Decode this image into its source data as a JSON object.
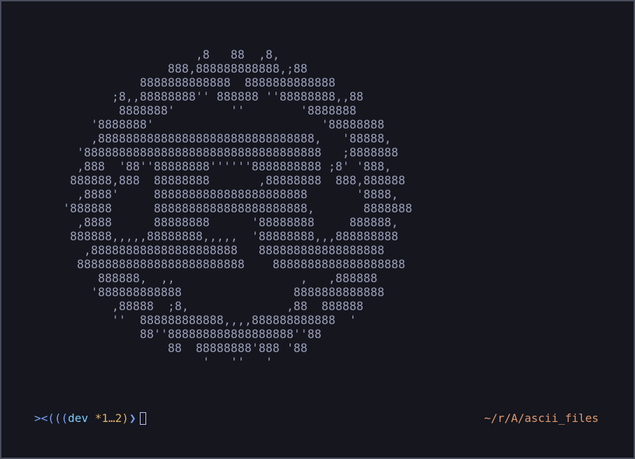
{
  "ascii_art": {
    "lines": [
      "                   ,8   88  ,8,",
      "               888,888888888888,;88",
      "           8888888888888  8888888888888",
      "       ;8,,88888888'' 888888 ''88888888,,88",
      "        8888888'        ''        '8888888",
      "    '8888888'                        '88888888",
      "    ,8888888888888888888888888888888,   '88888,",
      "  '8888888888888888888888888888888888   ;8888888",
      "  ,888  '88''88888888''''''8888888888 ;8' '888,",
      " 888888,888  88888888       ,88888888  888,888888",
      "  ,8888'     8888888888888888888888       '8888,",
      "'888888      8888888888888888888888,       8888888",
      "  ,8888      88888888      '88888888     888888,",
      " 888888,,,,,88888888,,,,,  '88888888,,,888888888",
      "   ,888888888888888888888   888888888888888888",
      "  888888888888888888888888    8888888888888888888",
      "     888888,  ,,                  ,   ,888888",
      "    '888888888888                8888888888888",
      "       ,88888  ;8,              ,88  888888",
      "       ''  888888888888,,,,888888888888  '",
      "           88''888888888888888888''88",
      "               88  88888888'888 '88",
      "                    '   ''   '"
    ]
  },
  "prompt": {
    "fish": "><(((",
    "branch": "dev",
    "dirty": " *1…2)",
    "arrow": "❯"
  },
  "cwd": "~/r/A/ascii_files",
  "colors": {
    "background": "#15161e",
    "ascii": "#9a9fb8",
    "prompt_blue": "#7aa2f7",
    "cwd_orange": "#e0976d"
  }
}
